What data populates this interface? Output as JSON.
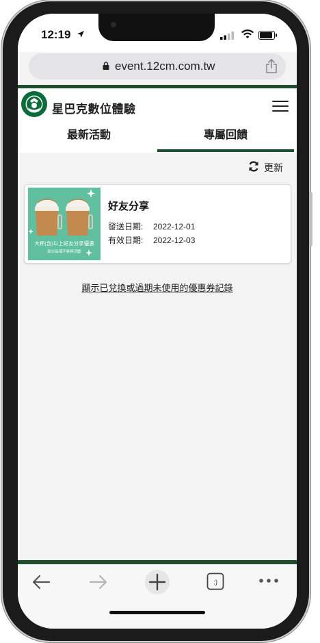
{
  "status_bar": {
    "time": "12:19"
  },
  "browser": {
    "url": "event.12cm.com.tw"
  },
  "site": {
    "title": "星巴克數位體驗"
  },
  "tabs": [
    {
      "label": "最新活動",
      "active": false
    },
    {
      "label": "專屬回饋",
      "active": true
    }
  ],
  "refresh_label": "更新",
  "coupon": {
    "title": "好友分享",
    "send_date_label": "發送日期:",
    "send_date": "2022-12-01",
    "valid_date_label": "有效日期:",
    "valid_date": "2022-12-03",
    "image_text_main": "大杯(含)以上好友分享優惠",
    "image_text_sub": "部分品項不參與活動"
  },
  "history_link": "顯示已兌換或過期未使用的優惠券記錄",
  "colors": {
    "brand_green": "#1e4e2e",
    "coupon_bg": "#5fbf9e"
  },
  "toolbar_icons": [
    "back-arrow-icon",
    "forward-arrow-icon",
    "new-tab-plus-icon",
    "tabs-icon",
    "more-icon"
  ]
}
